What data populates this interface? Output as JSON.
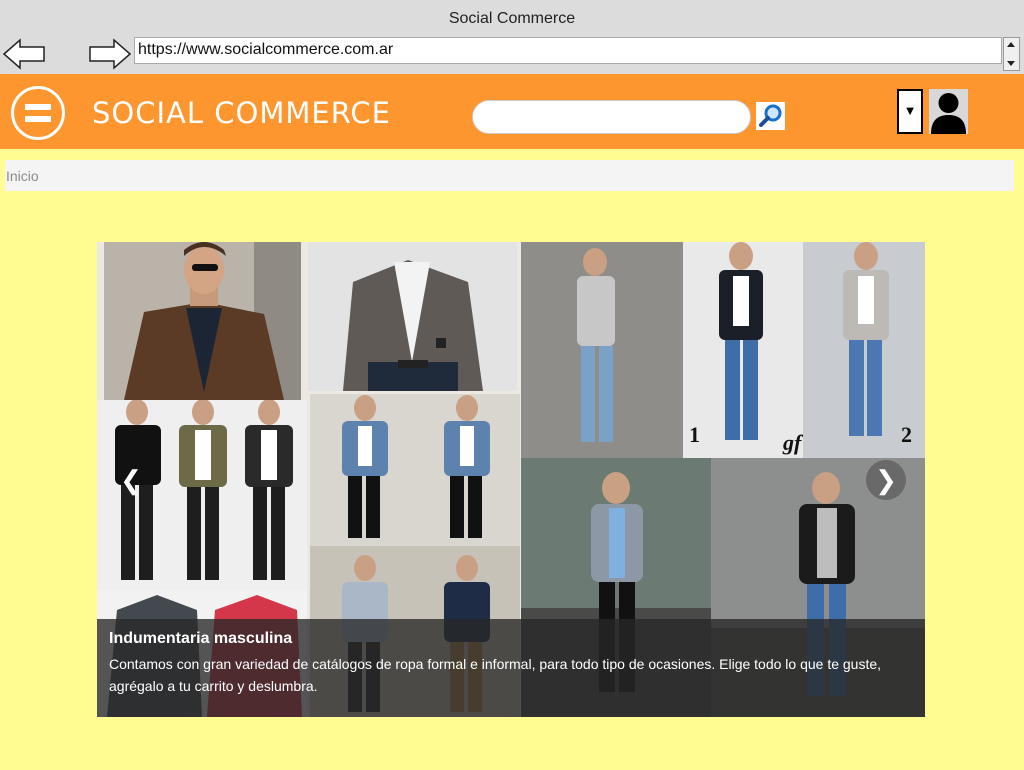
{
  "window": {
    "title": "Social Commerce"
  },
  "browser": {
    "url": "https://www.socialcommerce.com.ar"
  },
  "header": {
    "brand": "SOCIAL COMMERCE",
    "search_placeholder": "",
    "dropdown_symbol": "▼"
  },
  "breadcrumb": {
    "current": "Inicio"
  },
  "carousel": {
    "prev_symbol": "❮",
    "next_symbol": "❯",
    "caption_title": "Indumentaria masculina",
    "caption_text": "Contamos con gran variedad de catálogos de ropa formal e informal, para todo tipo de ocasiones. Elige todo lo que te guste, agrégalo a tu carrito y deslumbra.",
    "photo_labels": {
      "left": "1",
      "middle": "gf",
      "right": "2"
    }
  },
  "icons": [
    "back-arrow-icon",
    "forward-arrow-icon",
    "hamburger-menu-icon",
    "search-icon",
    "dropdown-icon",
    "user-icon"
  ],
  "colors": {
    "header": "#fd962f",
    "page_background": "#fffd92",
    "chrome": "#dcdcdc"
  }
}
